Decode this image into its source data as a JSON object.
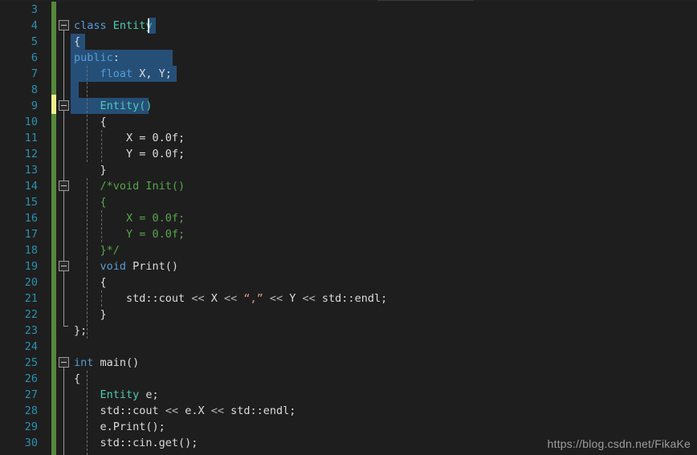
{
  "editor": {
    "theme": "visual-studio-dark",
    "language": "cpp",
    "colors": {
      "background": "#1e1e1e",
      "selection": "#264f78",
      "line_number": "#2b91af",
      "keyword": "#569cd6",
      "type": "#4ec9b0",
      "plain": "#dcdcdc",
      "string": "#d69d85",
      "comment": "#57a64a",
      "change_bar_saved": "#56893b",
      "change_bar_unsaved": "#f0f08a",
      "fold_box_border": "#9a9a9a"
    },
    "first_visible_line": 3,
    "last_visible_line": 30
  },
  "line_numbers": [
    "3",
    "4",
    "5",
    "6",
    "7",
    "8",
    "9",
    "10",
    "11",
    "12",
    "13",
    "14",
    "15",
    "16",
    "17",
    "18",
    "19",
    "20",
    "21",
    "22",
    "23",
    "24",
    "25",
    "26",
    "27",
    "28",
    "29",
    "30"
  ],
  "lines": [
    {
      "n": "3",
      "text": ""
    },
    {
      "n": "4",
      "text": "class Entity"
    },
    {
      "n": "5",
      "text": "{"
    },
    {
      "n": "6",
      "text": "public:"
    },
    {
      "n": "7",
      "text": "    float X, Y;"
    },
    {
      "n": "8",
      "text": ""
    },
    {
      "n": "9",
      "text": "    Entity()"
    },
    {
      "n": "10",
      "text": "    {"
    },
    {
      "n": "11",
      "text": "        X = 0.0f;"
    },
    {
      "n": "12",
      "text": "        Y = 0.0f;"
    },
    {
      "n": "13",
      "text": "    }"
    },
    {
      "n": "14",
      "text": "    /*void Init()"
    },
    {
      "n": "15",
      "text": "    {"
    },
    {
      "n": "16",
      "text": "        X = 0.0f;"
    },
    {
      "n": "17",
      "text": "        Y = 0.0f;"
    },
    {
      "n": "18",
      "text": "    }*/"
    },
    {
      "n": "19",
      "text": "    void Print()"
    },
    {
      "n": "20",
      "text": "    {"
    },
    {
      "n": "21",
      "text": "        std::cout << X << \",\" << Y << std::endl;"
    },
    {
      "n": "22",
      "text": "    }"
    },
    {
      "n": "23",
      "text": "};"
    },
    {
      "n": "24",
      "text": ""
    },
    {
      "n": "25",
      "text": "int main()"
    },
    {
      "n": "26",
      "text": "{"
    },
    {
      "n": "27",
      "text": "    Entity e;"
    },
    {
      "n": "28",
      "text": "    std::cout << e.X << std::endl;"
    },
    {
      "n": "29",
      "text": "    e.Print();"
    },
    {
      "n": "30",
      "text": "    std::cin.get();"
    }
  ],
  "tokens": {
    "l4_kw_class": "class",
    "l4_type_entity": " Entity",
    "l5_brace": "{",
    "l6_kw_public": "public",
    "l6_colon": ":",
    "l7_kw_float": "    float",
    "l7_vars": " X, Y;",
    "l9_ctor": "    Entity()",
    "l10_brace": "    {",
    "l11_assign": "        X = 0.0f;",
    "l12_assign": "        Y = 0.0f;",
    "l13_brace": "    }",
    "l14_comment": "    /*void Init()",
    "l15_comment": "    {",
    "l16_comment": "        X = 0.0f;",
    "l17_comment": "        Y = 0.0f;",
    "l18_comment": "    }*/",
    "l19_kw_void": "    void",
    "l19_print": " Print()",
    "l20_brace": "    {",
    "l21_pre": "        std::cout ",
    "l21_op1": "<<",
    "l21_x": " X ",
    "l21_op2": "<<",
    "l21_str": " “,” ",
    "l21_op3": "<<",
    "l21_y": " Y ",
    "l21_op4": "<<",
    "l21_end": " std::endl;",
    "l22_brace": "    }",
    "l23_end": "};",
    "l25_kw_int": "int",
    "l25_main": " main()",
    "l26_brace": "{",
    "l27_type": "    Entity",
    "l27_var": " e;",
    "l28_pre": "    std::cout ",
    "l28_op1": "<<",
    "l28_ex": " e.X ",
    "l28_op2": "<<",
    "l28_end": " std::endl;",
    "l29_call": "    e.Print();",
    "l30_call": "    std::cin.get();"
  },
  "folding": {
    "boxes": [
      {
        "line": "4",
        "state": "expanded"
      },
      {
        "line": "9",
        "state": "expanded"
      },
      {
        "line": "14",
        "state": "expanded"
      },
      {
        "line": "19",
        "state": "expanded"
      },
      {
        "line": "25",
        "state": "expanded"
      }
    ]
  },
  "change_bar": {
    "segments": [
      {
        "from_line": "3",
        "to_line": "8",
        "state": "saved"
      },
      {
        "from_line": "9",
        "to_line": "9",
        "state": "unsaved"
      },
      {
        "from_line": "10",
        "to_line": "30",
        "state": "saved"
      }
    ]
  },
  "selection": {
    "active": true,
    "anchor_line": "4",
    "caret_line": "9",
    "description": "multi-line selection from end of class Entity through Entity()"
  },
  "watermark": {
    "text": "https://blog.csdn.net/FikaKe"
  }
}
